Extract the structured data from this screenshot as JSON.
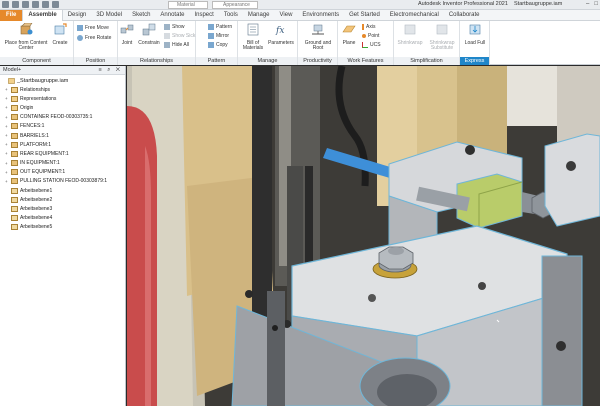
{
  "titlebar": {
    "material": "Material",
    "appearance": "Appearance",
    "app_title": "Autodesk Inventor Professional 2021",
    "document": "Startbaugruppe.iam"
  },
  "tabs": [
    "Assemble",
    "Design",
    "3D Model",
    "Sketch",
    "Annotate",
    "Inspect",
    "Tools",
    "Manage",
    "View",
    "Environments",
    "Get Started",
    "Electromechanical",
    "Collaborate"
  ],
  "file_tab": "File",
  "ribbon": {
    "component": {
      "title": "Component",
      "place": "Place from Content Center",
      "create": "Create"
    },
    "position": {
      "title": "Position",
      "free_move": "Free Move",
      "free_rotate": "Free Rotate"
    },
    "relationships": {
      "title": "Relationships",
      "joint": "Joint",
      "constrain": "Constrain",
      "show": "Show",
      "show_sick": "Show Sick",
      "hide_all": "Hide All"
    },
    "pattern": {
      "title": "Pattern",
      "pattern": "Pattern",
      "mirror": "Mirror",
      "copy": "Copy"
    },
    "manage": {
      "title": "Manage",
      "bom": "Bill of Materials",
      "parameters": "Parameters"
    },
    "productivity": {
      "title": "Productivity",
      "ground_root": "Ground and Root"
    },
    "work_features": {
      "title": "Work Features",
      "plane": "Plane",
      "axis": "Axis",
      "point": "Point",
      "ucs": "UCS"
    },
    "simplification": {
      "title": "Simplification",
      "shrinkwrap": "Shrinkwrap",
      "shrinkwrap_sub": "Shrinkwrap Substitute"
    },
    "express": {
      "title": "Express",
      "load_full": "Load Full"
    }
  },
  "browser": {
    "header": "Model",
    "root": "_Startbaugruppe.iam",
    "items": [
      {
        "label": "Relationships",
        "expand": "+"
      },
      {
        "label": "Representations",
        "expand": "+"
      },
      {
        "label": "Origin",
        "expand": "+"
      },
      {
        "label": "CONTAINER FEOD-00303735:1",
        "expand": "+"
      },
      {
        "label": "FENCES:1",
        "expand": "+"
      },
      {
        "label": "BARRIELS:1",
        "expand": "+"
      },
      {
        "label": "PLATFORM:1",
        "expand": "+"
      },
      {
        "label": "REAR EQUIPMENT:1",
        "expand": "+"
      },
      {
        "label": "IN EQUIPMENT:1",
        "expand": "+"
      },
      {
        "label": "OUT EQUIPMENT:1",
        "expand": "+"
      },
      {
        "label": "PULLING STATION FEOD-00303879:1",
        "expand": "+"
      },
      {
        "label": "Arbeitsebene1",
        "expand": ""
      },
      {
        "label": "Arbeitsebene2",
        "expand": ""
      },
      {
        "label": "Arbeitsebene3",
        "expand": ""
      },
      {
        "label": "Arbeitsebene4",
        "expand": ""
      },
      {
        "label": "Arbeitsebene5",
        "expand": ""
      }
    ]
  },
  "colors": {
    "accent": "#e6892a",
    "express": "#1f86c9",
    "highlight_edges": "#6fb6d8"
  }
}
